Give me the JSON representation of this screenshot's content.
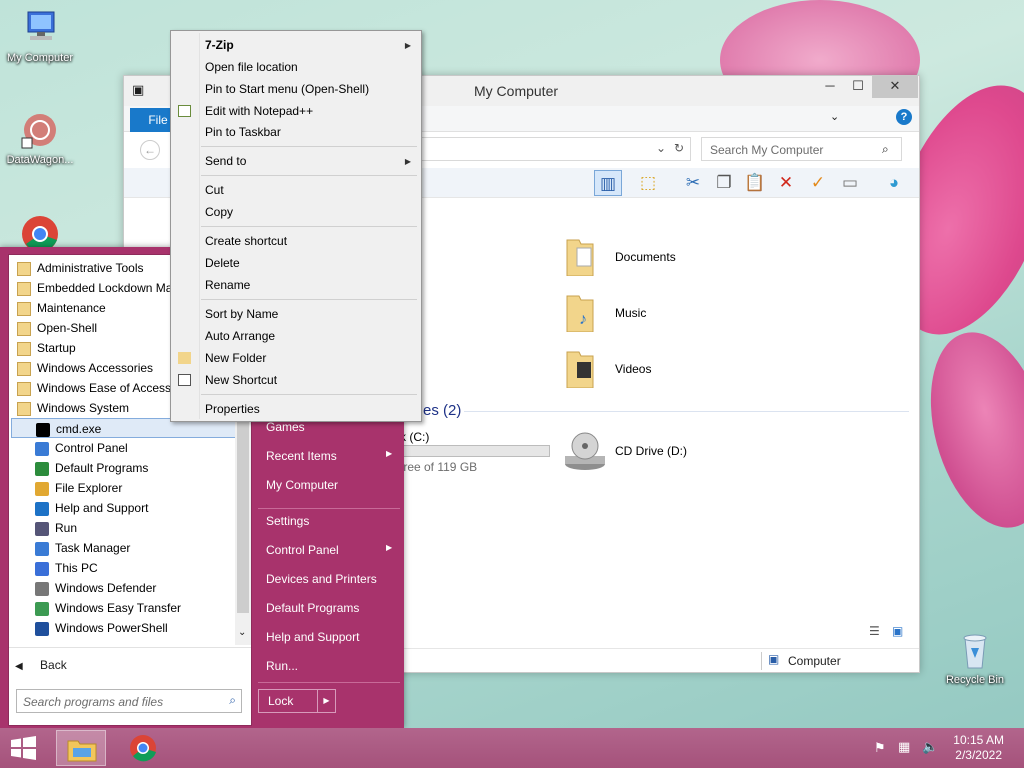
{
  "desktop": {
    "icons": [
      {
        "label": "My Computer"
      },
      {
        "label": "DataWagon..."
      },
      {
        "label": "Recycle Bin"
      }
    ]
  },
  "explorer": {
    "title": "My Computer",
    "ribbon_tab": "File",
    "search_placeholder": "Search My Computer",
    "folders": [
      "Documents",
      "Music",
      "Videos"
    ],
    "devices_header": "es (2)",
    "local_disk_label": "sk (C:)",
    "local_disk_free": "free of 119 GB",
    "local_disk_used_fraction": 0.0,
    "cd_drive": "CD Drive (D:)",
    "status_location": "Computer"
  },
  "context_menu": {
    "items": [
      {
        "label": "7-Zip",
        "submenu": true,
        "bold": true
      },
      {
        "label": "Open file location"
      },
      {
        "label": "Pin to Start menu (Open-Shell)"
      },
      {
        "label": "Edit with Notepad++",
        "icon": "notepad-icon"
      },
      {
        "label": "Pin to Taskbar"
      },
      {
        "label": "Send to",
        "submenu": true
      },
      {
        "label": "Cut"
      },
      {
        "label": "Copy"
      },
      {
        "label": "Create shortcut"
      },
      {
        "label": "Delete"
      },
      {
        "label": "Rename"
      },
      {
        "label": "Sort by Name"
      },
      {
        "label": "Auto Arrange"
      },
      {
        "label": "New Folder",
        "icon": "folder-icon"
      },
      {
        "label": "New Shortcut",
        "icon": "shortcut-icon"
      },
      {
        "label": "Properties"
      }
    ]
  },
  "start_menu": {
    "folders": [
      "Administrative Tools",
      "Embedded Lockdown Ma",
      "Maintenance",
      "Open-Shell",
      "Startup",
      "Windows Accessories",
      "Windows Ease of Access",
      "Windows System"
    ],
    "programs": [
      "cmd.exe",
      "Control Panel",
      "Default Programs",
      "File Explorer",
      "Help and Support",
      "Run",
      "Task Manager",
      "This PC",
      "Windows Defender",
      "Windows Easy Transfer",
      "Windows PowerShell"
    ],
    "back_label": "Back",
    "search_placeholder": "Search programs and files",
    "right_items": [
      {
        "label": "Games"
      },
      {
        "label": "Recent Items",
        "submenu": true
      },
      {
        "label": "My Computer"
      },
      {
        "label": "Settings"
      },
      {
        "label": "Control Panel",
        "submenu": true
      },
      {
        "label": "Devices and Printers"
      },
      {
        "label": "Default Programs"
      },
      {
        "label": "Help and Support"
      },
      {
        "label": "Run..."
      }
    ],
    "lock_label": "Lock"
  },
  "taskbar": {
    "time": "10:15 AM",
    "date": "2/3/2022"
  },
  "colors": {
    "start_menu": "#a8336c",
    "taskbar": "#a5527b",
    "accent": "#1979ca"
  }
}
